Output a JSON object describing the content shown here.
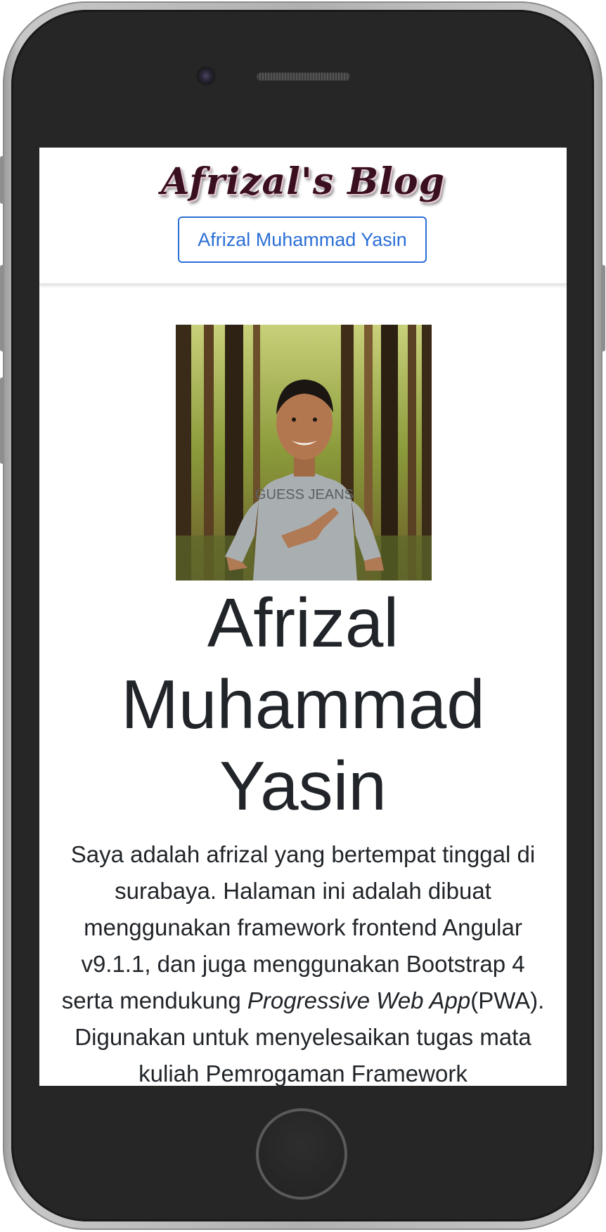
{
  "header": {
    "brand": "Afrizal's Blog",
    "nav_button": "Afrizal Muhammad Yasin"
  },
  "profile": {
    "photo_alt": "profile-photo",
    "shirt_text": "GUESS JEANS",
    "name": "Afrizal Muhammad Yasin",
    "bio_part1": "Saya adalah afrizal yang bertempat tinggal di surabaya. Halaman ini adalah dibuat menggunakan framework frontend Angular v9.1.1, dan juga menggunakan Bootstrap 4 serta mendukung ",
    "bio_emphasis": "Progressive Web App",
    "bio_part2": "(PWA). Digunakan untuk menyelesaikan tugas mata kuliah Pemrogaman Framework"
  },
  "colors": {
    "link_blue": "#2b6fd6",
    "text": "#212529",
    "brand": "#3a0f1f"
  }
}
